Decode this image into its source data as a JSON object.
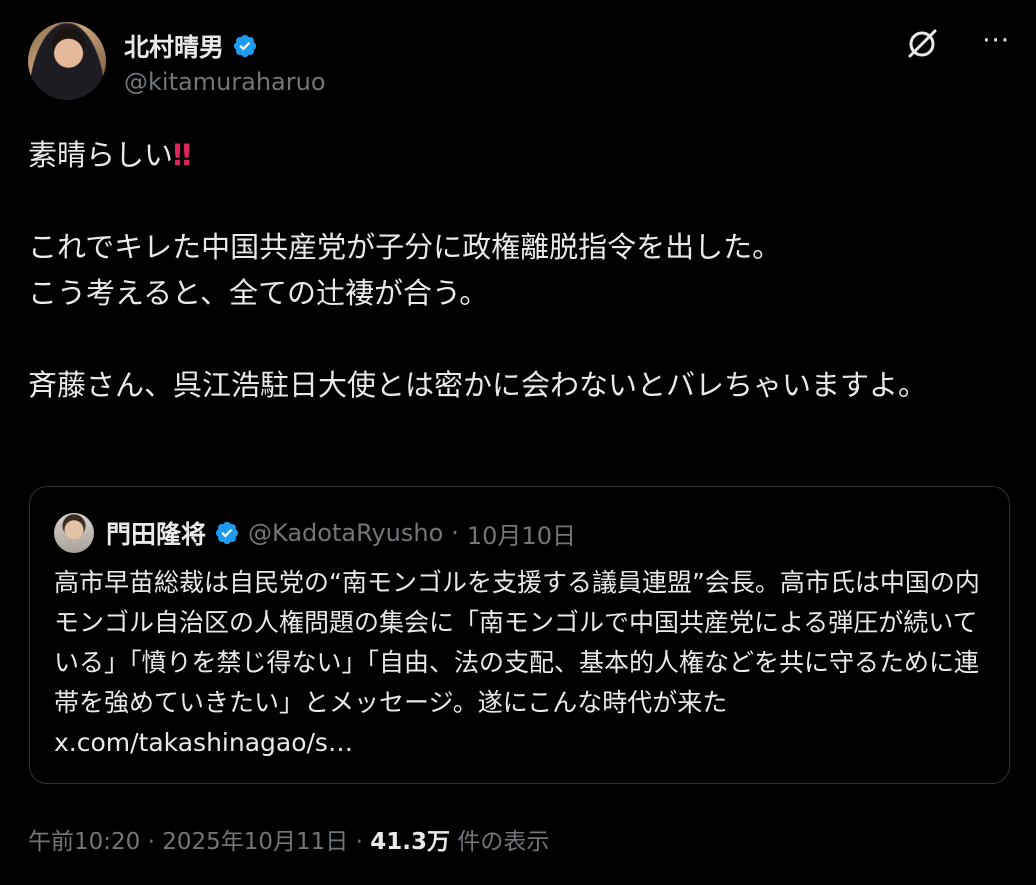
{
  "author": {
    "name": "北村晴男",
    "handle": "@kitamuraharuo"
  },
  "tweet": {
    "line1": "素晴らしい",
    "emoji": "‼",
    "paragraph2": "これでキレた中国共産党が子分に政権離脱指令を出した。\nこう考えると、全ての辻褄が合う。",
    "paragraph3": "斉藤さん、呉江浩駐日大使とは密かに会わないとバレちゃいますよ。"
  },
  "quote": {
    "name": "門田隆将",
    "handle": "@KadotaRyusho",
    "separator": "·",
    "date": "10月10日",
    "text": "高市早苗総裁は自民党の“南モンゴルを支援する議員連盟”会長。高市氏は中国の内モンゴル自治区の人権問題の集会に「南モンゴルで中国共産党による弾圧が続いている」「憤りを禁じ得ない」「自由、法の支配、基本的人権などを共に守るために連帯を強めていきたい」とメッセージ。遂にこんな時代が来た x.com/takashinagao/s…"
  },
  "footer": {
    "time": "午前10:20",
    "sep1": "·",
    "date": "2025年10月11日",
    "sep2": "·",
    "views": "41.3万",
    "views_label": "件の表示"
  },
  "icons": {
    "verified_color": "#1d9bf0",
    "grok": "grok-icon",
    "more": "more-icon"
  }
}
